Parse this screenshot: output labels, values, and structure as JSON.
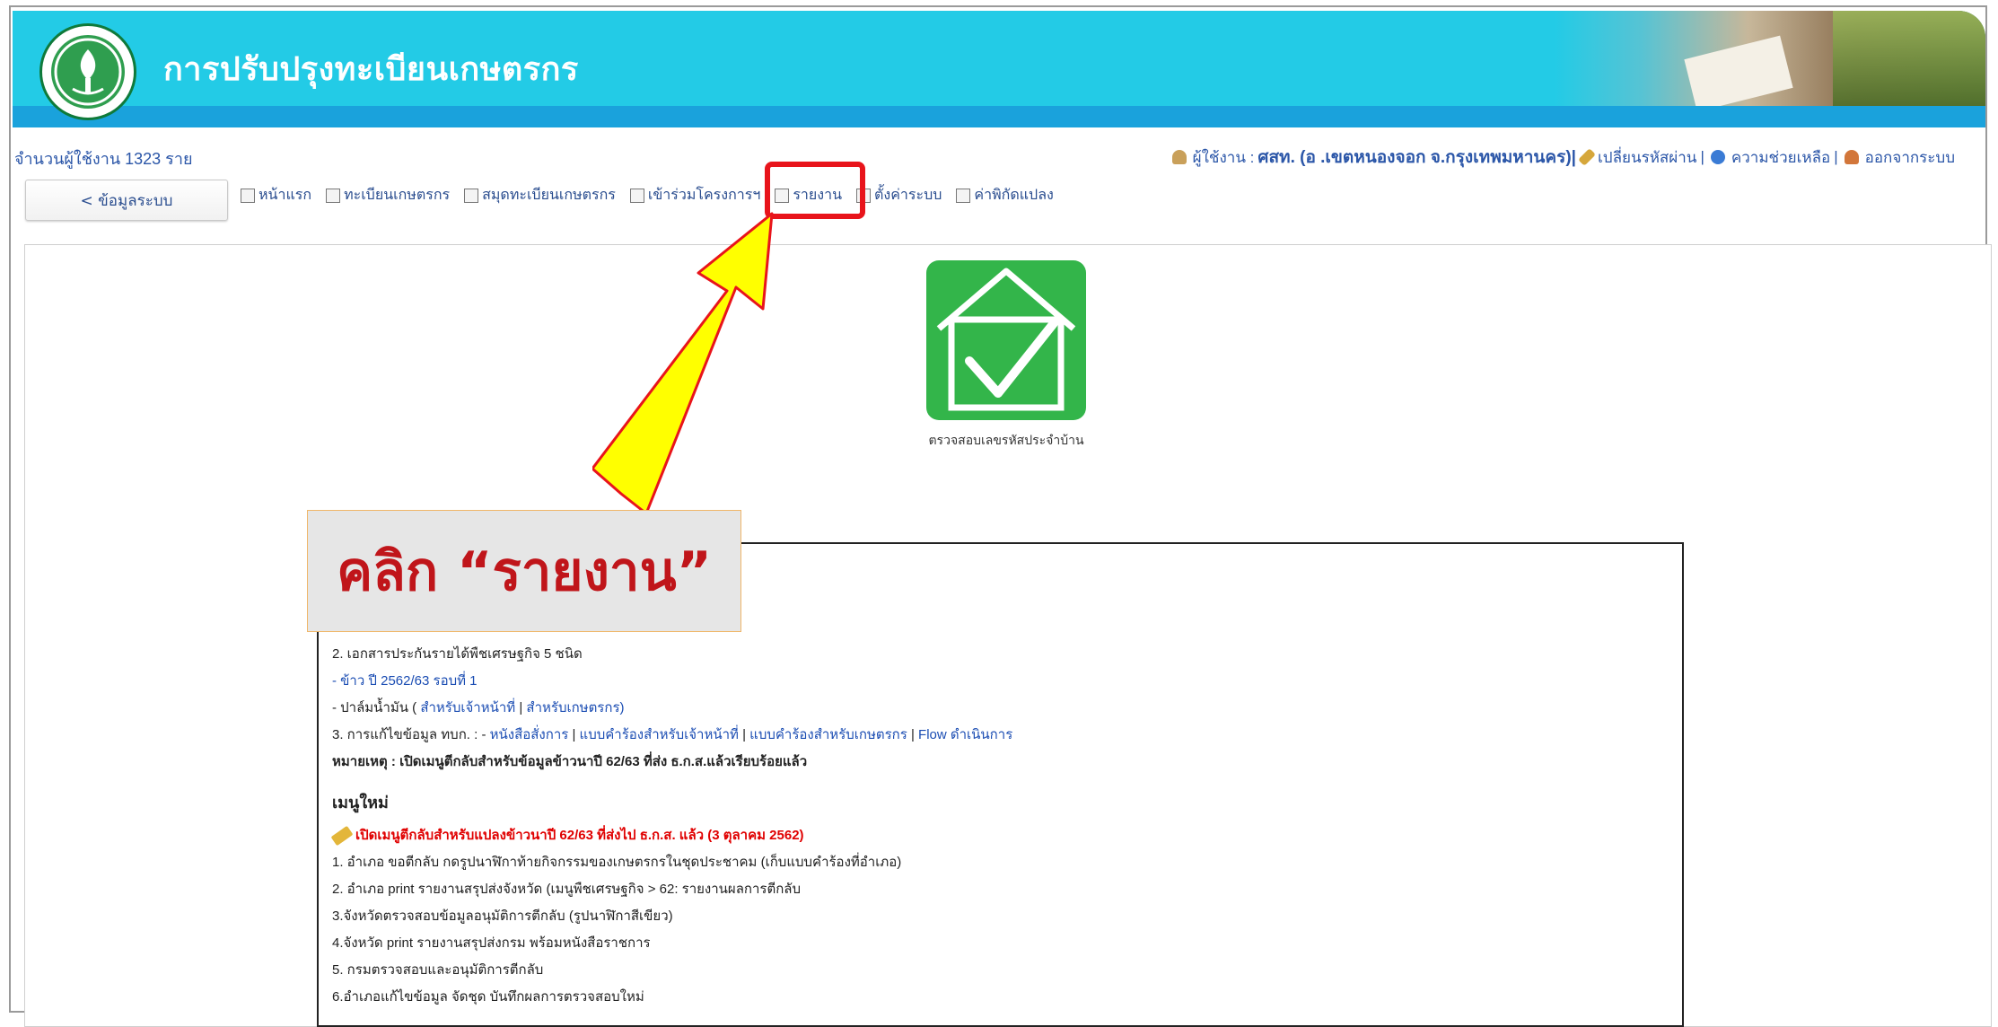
{
  "header": {
    "title": "การปรับปรุงทะเบียนเกษตรกร"
  },
  "info": {
    "user_count": "จำนวนผู้ใช้งาน 1323 ราย",
    "user_label": "ผู้ใช้งาน : ",
    "user_name": "ศสท. (อ .เขตหนองจอก จ.กรุงเทพมหานคร)|",
    "change_password": "เปลี่ยนรหัสผ่าน",
    "help": "ความช่วยเหลือ",
    "logout": "ออกจากระบบ",
    "sep": "|"
  },
  "nav": {
    "back_button": "< ข้อมูลระบบ",
    "items": [
      {
        "label": "หน้าแรก"
      },
      {
        "label": "ทะเบียนเกษตรกร"
      },
      {
        "label": "สมุดทะเบียนเกษตรกร"
      },
      {
        "label": "เข้าร่วมโครงการฯ"
      },
      {
        "label": "รายงาน"
      },
      {
        "label": "ตั้งค่าระบบ"
      },
      {
        "label": "ค่าพิกัดแปลง"
      }
    ]
  },
  "tile": {
    "label": "ตรวจสอบเลขรหัสประจำบ้าน"
  },
  "callout": {
    "text": "คลิก “รายงาน”"
  },
  "notice": {
    "l1": "2. เอกสารประกันรายได้พืชเศรษฐกิจ 5 ชนิด",
    "l2": "- ข้าว ปี 2562/63 รอบที่ 1",
    "l3a": "- ปาล์มน้ำมัน ( ",
    "l3b": "สำหรับเจ้าหน้าที่",
    "l3c": " | ",
    "l3d": "สำหรับเกษตรกร)",
    "l4a": "3. การแก้ไขข้อมูล ทบก. : - ",
    "l4b": "หนังสือสั่งการ",
    "l4c": " | ",
    "l4d": "แบบคำร้องสำหรับเจ้าหน้าที่",
    "l4e": " | ",
    "l4f": "แบบคำร้องสำหรับเกษตรกร",
    "l4g": " | ",
    "l4h": "Flow ดำเนินการ",
    "l5": "หมายเหตุ : เปิดเมนูตีกลับสำหรับข้อมูลข้าวนาปี 62/63 ที่ส่ง ธ.ก.ส.แล้วเรียบร้อยแล้ว",
    "new_menu": "เมนูใหม่",
    "red_line": "เปิดเมนูตีกลับสำหรับแปลงข้าวนาปี 62/63 ที่ส่งไป ธ.ก.ส. แล้ว (3 ตุลาคม 2562)",
    "s1": "1. อำเภอ ขอตีกลับ กดรูปนาฬิกาท้ายกิจกรรมของเกษตรกรในชุดประชาคม (เก็บแบบคำร้องที่อำเภอ)",
    "s2": "2. อำเภอ print รายงานสรุปส่งจังหวัด (เมนูพืชเศรษฐกิจ > 62: รายงานผลการตีกลับ",
    "s3": "3.จังหวัดตรวจสอบข้อมูลอนุมัติการตีกลับ (รูปนาฬิกาสีเขียว)",
    "s4": "4.จังหวัด print รายงานสรุปส่งกรม พร้อมหนังสือราชการ",
    "s5": "5. กรมตรวจสอบและอนุมัติการตีกลับ",
    "s6": "6.อำเภอแก้ไขข้อมูล จัดชุด บันทึกผลการตรวจสอบใหม่"
  }
}
